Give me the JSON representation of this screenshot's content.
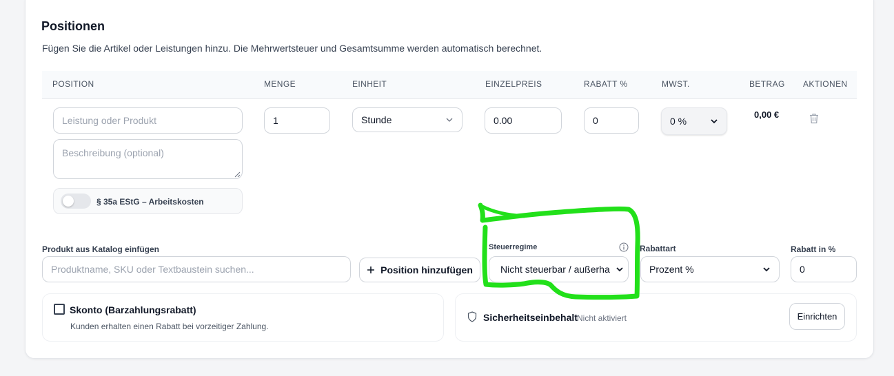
{
  "section": {
    "title": "Positionen",
    "subtitle": "Fügen Sie die Artikel oder Leistungen hinzu. Die Mehrwertsteuer und Gesamtsumme werden automatisch berechnet."
  },
  "table": {
    "headers": {
      "position": "POSITION",
      "menge": "MENGE",
      "einheit": "EINHEIT",
      "einzelpreis": "EINZELPREIS",
      "rabatt": "RABATT %",
      "mwst": "MWST.",
      "betrag": "BETRAG",
      "aktionen": "AKTIONEN"
    },
    "row": {
      "position_placeholder": "Leistung oder Produkt",
      "beschreibung_placeholder": "Beschreibung (optional)",
      "menge": "1",
      "einheit": "Stunde",
      "einzelpreis": "0.00",
      "rabatt": "0",
      "mwst": "0 %",
      "betrag": "0,00 €",
      "toggle_label": "§ 35a EStG – Arbeitskosten"
    }
  },
  "catalog": {
    "label": "Produkt aus Katalog einfügen",
    "placeholder": "Produktname, SKU oder Textbaustein suchen..."
  },
  "add_button": {
    "icon": "plus-icon",
    "label": "Position hinzufügen"
  },
  "steuerregime": {
    "label": "Steuerregime",
    "value": "Nicht steuerbar / außerha",
    "info_icon": "info-icon"
  },
  "rabattart": {
    "label": "Rabattart",
    "value": "Prozent %"
  },
  "rabatt_prozent": {
    "label": "Rabatt in %",
    "value": "0"
  },
  "skonto": {
    "title": "Skonto (Barzahlungsrabatt)",
    "description": "Kunden erhalten einen Rabatt bei vorzeitiger Zahlung."
  },
  "sicherheitseinbehalt": {
    "icon": "shield-icon",
    "title": "Sicherheitseinbehalt",
    "status": "Nicht aktiviert",
    "button": "Einrichten"
  },
  "colors": {
    "highlight": "#22e01a",
    "border": "#d1d5db",
    "text": "#111827"
  }
}
